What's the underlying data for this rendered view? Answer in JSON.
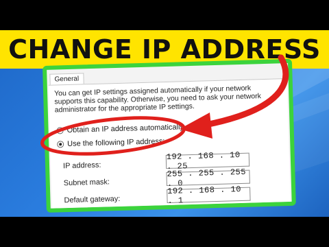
{
  "banner": {
    "title": "CHANGE IP ADDRESS"
  },
  "dialog": {
    "tab_label": "General",
    "description": "You can get IP settings assigned automatically if your network supports this capability. Otherwise, you need to ask your network administrator for the appropriate IP settings.",
    "radio_auto": {
      "label": "Obtain an IP address automatically",
      "checked": false
    },
    "radio_manual": {
      "label": "Use the following IP address:",
      "checked": true
    },
    "fields": [
      {
        "label": "IP address:",
        "value": "192 . 168 . 10 . 25"
      },
      {
        "label": "Subnet mask:",
        "value": "255 . 255 . 255 . 0"
      },
      {
        "label": "Default gateway:",
        "value": "192 . 168 . 10 . 1"
      }
    ]
  },
  "colors": {
    "banner_bg": "#ffe400",
    "dialog_border": "#3cd33c",
    "annotation": "#e0201c",
    "desktop": "#2b7ee0"
  },
  "icons": [
    "arrow-annotation-icon",
    "circle-annotation-icon"
  ]
}
